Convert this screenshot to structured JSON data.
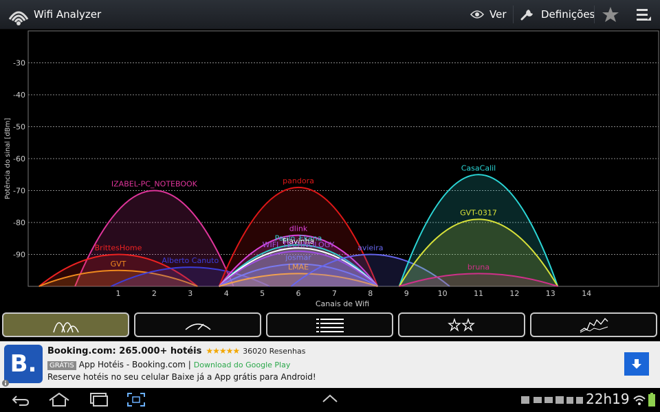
{
  "app": {
    "title": "Wifi Analyzer"
  },
  "actionbar": {
    "view_label": "Ver",
    "settings_label": "Definições"
  },
  "chart_data": {
    "type": "area",
    "ylabel": "Potência do sinal [dBm]",
    "xlabel": "Canais de Wifi",
    "ylim": [
      -100,
      -20
    ],
    "y_ticks": [
      -30,
      -40,
      -50,
      -60,
      -70,
      -80,
      -90
    ],
    "xlim": [
      -1.5,
      16
    ],
    "x_ticks": [
      1,
      2,
      3,
      4,
      5,
      6,
      7,
      8,
      9,
      10,
      11,
      12,
      13,
      14
    ],
    "grid": true,
    "networks": [
      {
        "name": "IZABEL-PC_NOTEBOOK",
        "channel": 2,
        "signal": -70,
        "color": "#e0359b"
      },
      {
        "name": "BrittesHome",
        "channel": 1,
        "signal": -90,
        "color": "#ee2222"
      },
      {
        "name": "GVT",
        "channel": 1,
        "signal": -95,
        "color": "#f08a1e"
      },
      {
        "name": "Alberto Canuto",
        "channel": 3,
        "signal": -94,
        "color": "#3d3dd8"
      },
      {
        "name": "pandora",
        "channel": 6,
        "signal": -69,
        "color": "#e01818"
      },
      {
        "name": "dlink",
        "channel": 6,
        "signal": -84,
        "color": "#dd44dd"
      },
      {
        "name": "Paulo_Ekana",
        "channel": 6,
        "signal": -87,
        "color": "#33cccc"
      },
      {
        "name": "Flavinha",
        "channel": 6,
        "signal": -88,
        "color": "#ffffff"
      },
      {
        "name": "WIFI_TECHNOLOGY",
        "channel": 6,
        "signal": -89,
        "color": "#a050e0"
      },
      {
        "name": "josmar",
        "channel": 6,
        "signal": -93,
        "color": "#7a7af0"
      },
      {
        "name": "LMAE",
        "channel": 6,
        "signal": -96,
        "color": "#f0a050"
      },
      {
        "name": "avieira",
        "channel": 8,
        "signal": -90,
        "color": "#6666ee"
      },
      {
        "name": "CasaCalil",
        "channel": 11,
        "signal": -65,
        "color": "#2bd6d6"
      },
      {
        "name": "GVT-0317",
        "channel": 11,
        "signal": -79,
        "color": "#d8e23a"
      },
      {
        "name": "bruna",
        "channel": 11,
        "signal": -96,
        "color": "#d0308a"
      }
    ]
  },
  "ad": {
    "logo_letter": "B.",
    "title": "Booking.com: 265.000+ hotéis",
    "stars": "★★★★★",
    "reviews": "36020 Resenhas",
    "badge": "GRÁTIS",
    "app_name": "App Hotéis - Booking.com |",
    "source": "Download do Google Play",
    "description": "Reserve hotéis no seu celular Baixe já a App grátis para Android!"
  },
  "status": {
    "time": "22h19"
  },
  "colors": {
    "grid": "#8a8a8a",
    "tab_active": "#6b6a3a",
    "ad_button": "#1a66d8"
  }
}
